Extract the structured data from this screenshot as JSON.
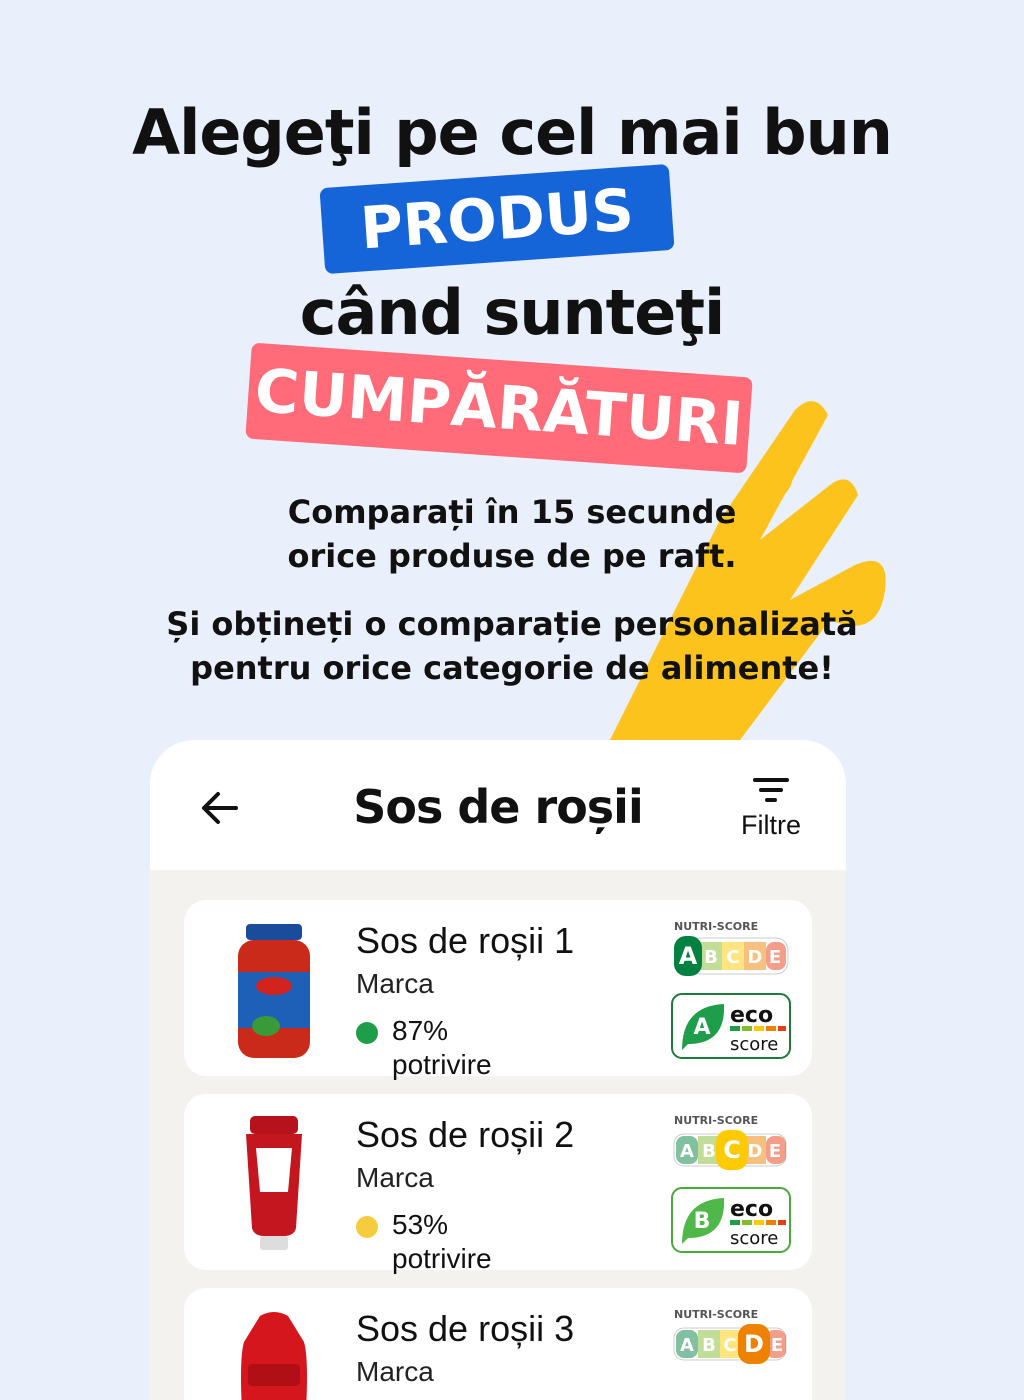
{
  "hero": {
    "line1": "Alegeţi pe cel mai bun",
    "tag1": "PRODUS",
    "line2": "când sunteţi",
    "tag2": "CUMPĂRĂTURI",
    "sub1_a": "Comparați în 15 secunde",
    "sub1_b": "orice produse de pe raft.",
    "sub2_a": "Și obțineți o comparație personalizată",
    "sub2_b": "pentru orice categorie de alimente!"
  },
  "appbar": {
    "title": "Sos de roșii",
    "filter_label": "Filtre"
  },
  "products": [
    {
      "name": "Sos de roșii 1",
      "brand": "Marca",
      "match": "87%",
      "match_label": "potrivire",
      "nutri": "A",
      "eco": "A",
      "dot_color": "#1e9e4a"
    },
    {
      "name": "Sos de roșii 2",
      "brand": "Marca",
      "match": "53%",
      "match_label": "potrivire",
      "nutri": "C",
      "eco": "B",
      "dot_color": "#f5cd3c"
    },
    {
      "name": "Sos de roșii 3",
      "brand": "Marca",
      "nutri": "D"
    }
  ],
  "badges": {
    "nutri_title": "NUTRI-SCORE",
    "letters": [
      "A",
      "B",
      "C",
      "D",
      "E"
    ],
    "eco_word": "eco",
    "score_word": "score"
  },
  "colors": {
    "background": "#e9effb",
    "tag_blue": "#1565d8",
    "tag_red": "#ff6b78",
    "hand": "#fcc31d",
    "nutri_a": "#038141",
    "nutri_b": "#85bb2f",
    "nutri_c": "#fecb02",
    "nutri_d": "#ee8100",
    "nutri_e": "#e63e11"
  }
}
